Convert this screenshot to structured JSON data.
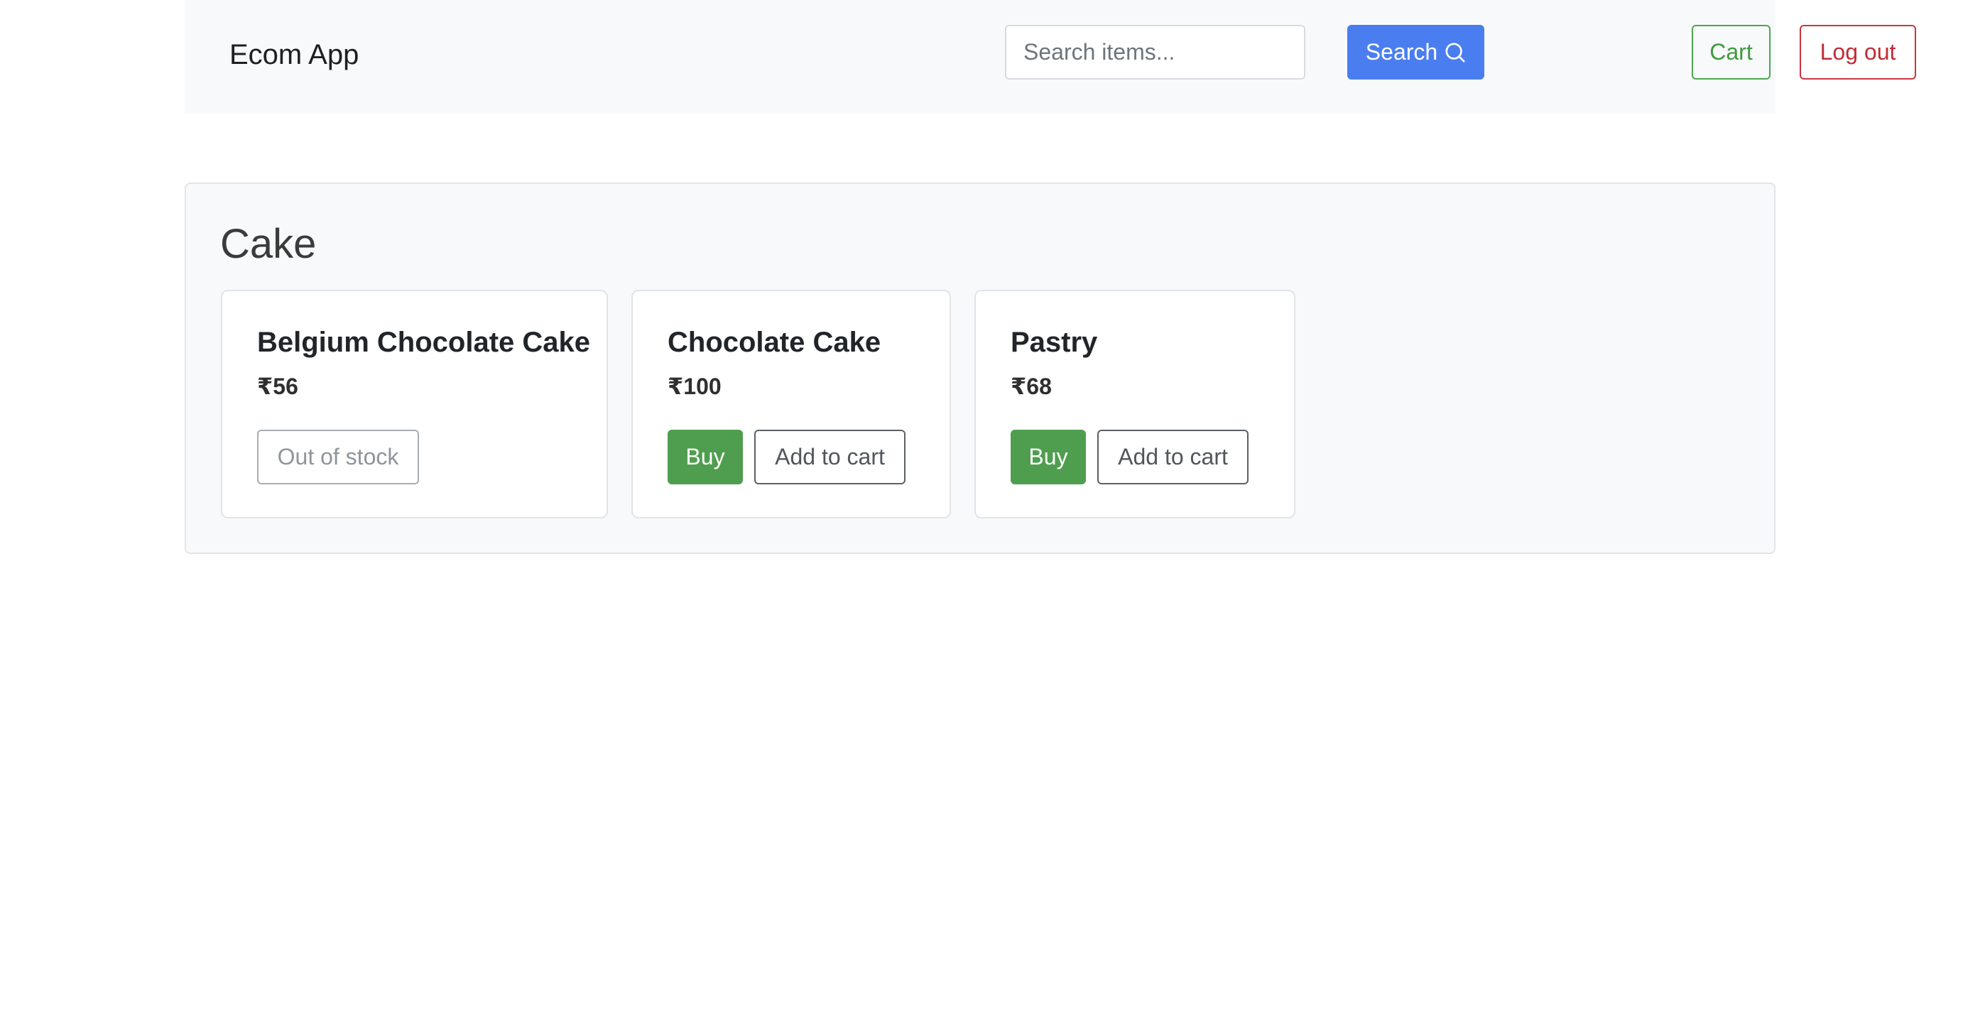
{
  "navbar": {
    "brand": "Ecom App",
    "search_placeholder": "Search items...",
    "search_value": "",
    "search_label": "Search",
    "cart_label": "Cart",
    "logout_label": "Log out"
  },
  "category": {
    "title": "Cake",
    "products": [
      {
        "name": "Belgium Chocolate Cake",
        "price": "₹56",
        "status_label": "Out of stock"
      },
      {
        "name": "Chocolate Cake",
        "price": "₹100",
        "buy_label": "Buy",
        "add_label": "Add to cart"
      },
      {
        "name": "Pastry",
        "price": "₹68",
        "buy_label": "Buy",
        "add_label": "Add to cart"
      }
    ]
  },
  "colors": {
    "primary": "#4a7ef0",
    "success": "#4f9e4f",
    "danger": "#c02c36",
    "panel_bg": "#f8f9fa"
  },
  "icons": {
    "search": "search-icon"
  }
}
